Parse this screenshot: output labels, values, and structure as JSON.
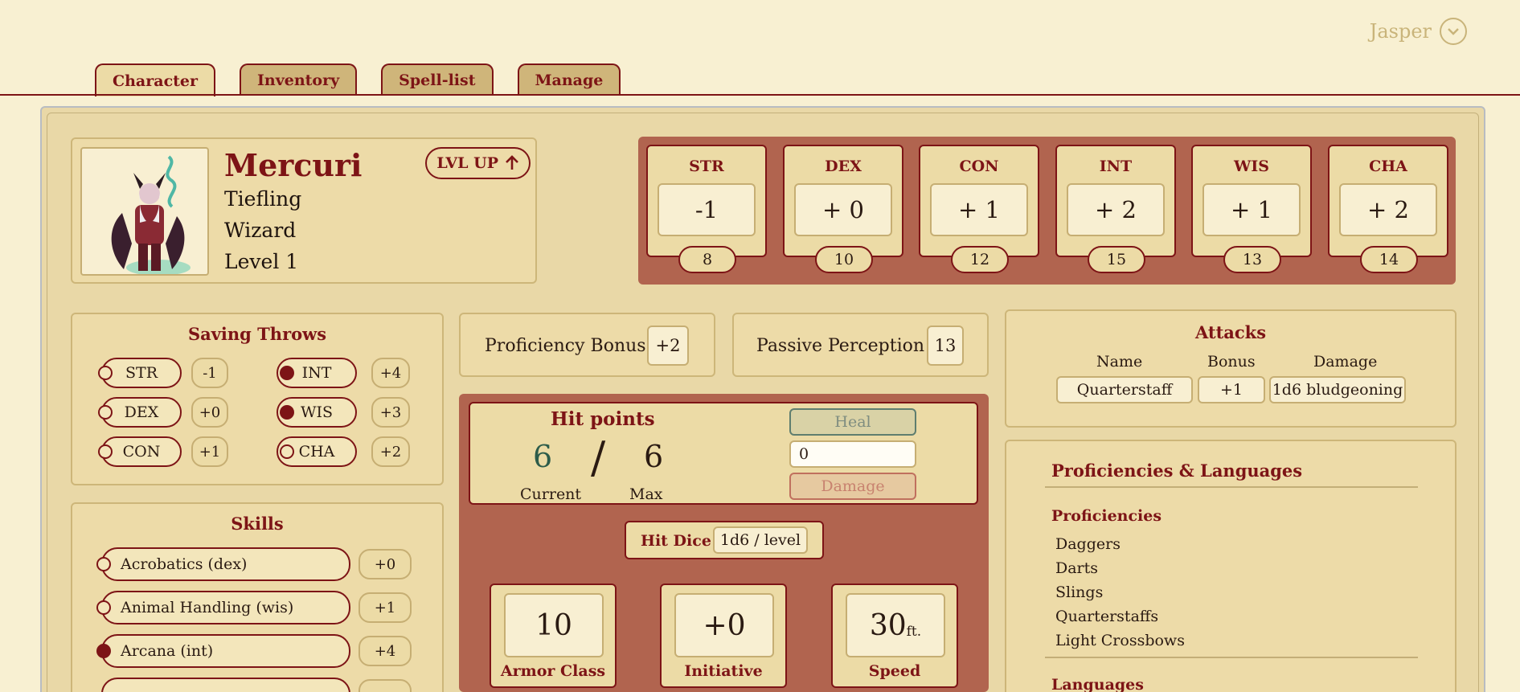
{
  "header": {
    "user_name": "Jasper"
  },
  "tabs": [
    {
      "label": "Character"
    },
    {
      "label": "Inventory"
    },
    {
      "label": "Spell-list"
    },
    {
      "label": "Manage"
    }
  ],
  "character": {
    "name": "Mercuri",
    "race": "Tiefling",
    "class": "Wizard",
    "level": "Level 1",
    "lvl_up_label": "LVL UP"
  },
  "abilities": [
    {
      "abbr": "STR",
      "mod": "-1",
      "score": "8"
    },
    {
      "abbr": "DEX",
      "mod": "+ 0",
      "score": "10"
    },
    {
      "abbr": "CON",
      "mod": "+ 1",
      "score": "12"
    },
    {
      "abbr": "INT",
      "mod": "+ 2",
      "score": "15"
    },
    {
      "abbr": "WIS",
      "mod": "+ 1",
      "score": "13"
    },
    {
      "abbr": "CHA",
      "mod": "+ 2",
      "score": "14"
    }
  ],
  "saving_throws": {
    "title": "Saving Throws",
    "items": [
      {
        "abbr": "STR",
        "value": "-1",
        "proficient": false
      },
      {
        "abbr": "DEX",
        "value": "+0",
        "proficient": false
      },
      {
        "abbr": "CON",
        "value": "+1",
        "proficient": false
      },
      {
        "abbr": "INT",
        "value": "+4",
        "proficient": true
      },
      {
        "abbr": "WIS",
        "value": "+3",
        "proficient": true
      },
      {
        "abbr": "CHA",
        "value": "+2",
        "proficient": false
      }
    ]
  },
  "skills": {
    "title": "Skills",
    "items": [
      {
        "name": "Acrobatics (dex)",
        "value": "+0",
        "proficient": false
      },
      {
        "name": "Animal Handling (wis)",
        "value": "+1",
        "proficient": false
      },
      {
        "name": "Arcana (int)",
        "value": "+4",
        "proficient": true
      }
    ]
  },
  "proficiency_bonus": {
    "label": "Proficiency Bonus",
    "value": "+2"
  },
  "passive_perception": {
    "label": "Passive Perception",
    "value": "13"
  },
  "hit_points": {
    "title": "Hit points",
    "current": "6",
    "slash": "/",
    "max": "6",
    "current_label": "Current",
    "max_label": "Max",
    "heal_label": "Heal",
    "amount_value": "0",
    "damage_label": "Damage"
  },
  "hit_dice": {
    "label": "Hit Dice",
    "value": "1d6 / level"
  },
  "combat": {
    "armor_class": {
      "value": "10",
      "label": "Armor Class"
    },
    "initiative": {
      "value": "+0",
      "label": "Initiative"
    },
    "speed": {
      "value": "30",
      "unit": "ft.",
      "label": "Speed"
    }
  },
  "attacks": {
    "title": "Attacks",
    "headers": [
      "Name",
      "Bonus",
      "Damage"
    ],
    "rows": [
      {
        "name": "Quarterstaff",
        "bonus": "+1",
        "damage": "1d6 bludgeoning"
      }
    ]
  },
  "proficiencies": {
    "title": "Proficiencies & Languages",
    "proficiencies_label": "Proficiencies",
    "items": [
      "Daggers",
      "Darts",
      "Slings",
      "Quarterstaffs",
      "Light Crossbows"
    ],
    "languages_label": "Languages"
  },
  "colors": {
    "accent": "#7d1416",
    "panel": "#b1644f",
    "background": "#f8f0d2",
    "card": "#eddba8"
  }
}
